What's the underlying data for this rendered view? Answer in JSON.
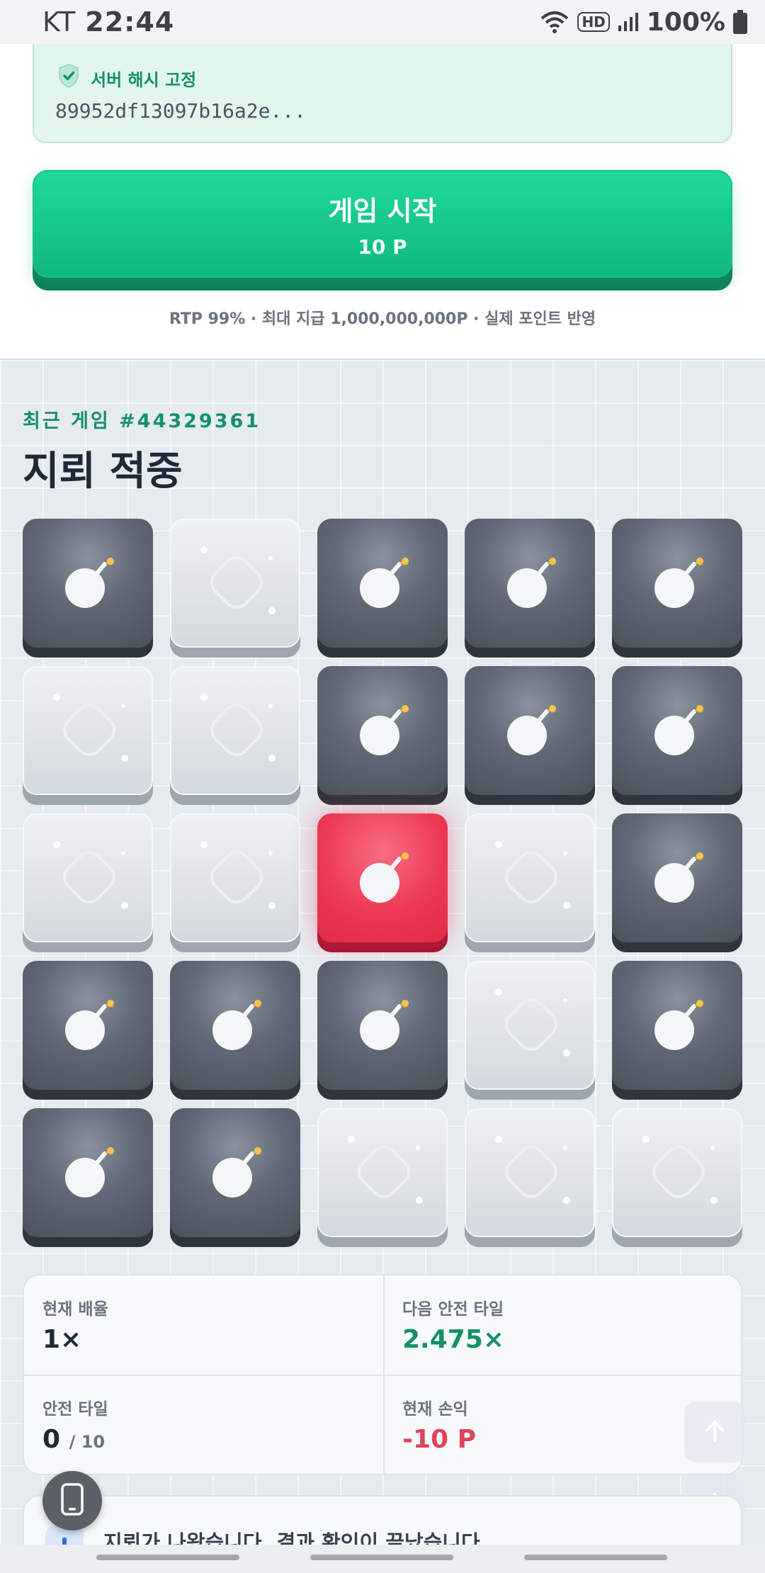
{
  "status_bar": {
    "carrier": "KT",
    "time": "22:44",
    "battery": "100%",
    "network_badge": "HD"
  },
  "hash_panel": {
    "title": "서버 해시 고정",
    "value": "89952df13097b16a2e...",
    "icon": "shield-check-icon"
  },
  "start_button": {
    "label": "게임 시작",
    "bet": "10 P"
  },
  "rtp_note": "RTP 99% · 최대 지급 1,000,000,000P · 실제 포인트 반영",
  "recent_game": {
    "label": "최근 게임 #44329361",
    "result_title": "지뢰 적중"
  },
  "board": {
    "rows": 5,
    "cols": 5,
    "tiles": [
      "mine",
      "safe",
      "mine",
      "mine",
      "mine",
      "safe",
      "safe",
      "mine",
      "mine",
      "mine",
      "safe",
      "safe",
      "hit",
      "safe",
      "mine",
      "mine",
      "mine",
      "mine",
      "safe",
      "mine",
      "mine",
      "mine",
      "safe",
      "safe",
      "safe"
    ]
  },
  "stats": {
    "current_multiplier": {
      "label": "현재 배율",
      "value": "1×"
    },
    "next_safe_tile": {
      "label": "다음 안전 타일",
      "value": "2.475×"
    },
    "safe_tiles": {
      "label": "안전 타일",
      "value": "0",
      "total": "/ 10"
    },
    "current_pnl": {
      "label": "현재 손익",
      "value": "-10 P"
    }
  },
  "notice": {
    "text": "지뢰가 나왔습니다. 결과 확인이 끝났습니다."
  },
  "colors": {
    "accent_green": "#149265",
    "button_green": "#1fd99a",
    "loss_red": "#e0435a",
    "mine_tile": "#4a525c",
    "hit_tile": "#ed3955",
    "safe_tile": "#dfe3e8"
  }
}
